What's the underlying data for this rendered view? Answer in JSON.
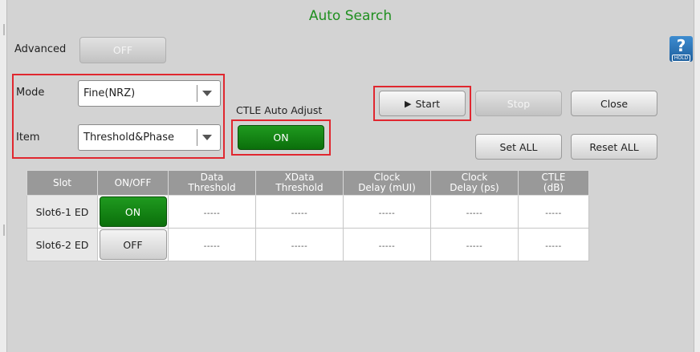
{
  "window": {
    "title": "Auto Search"
  },
  "advanced": {
    "label": "Advanced",
    "toggle": "OFF"
  },
  "mode": {
    "label": "Mode",
    "value": "Fine(NRZ)"
  },
  "item": {
    "label": "Item",
    "value": "Threshold&Phase"
  },
  "ctle": {
    "label": "CTLE Auto Adjust",
    "toggle": "ON"
  },
  "buttons": {
    "start": "Start",
    "start_glyph": "▶",
    "stop": "Stop",
    "close": "Close",
    "set_all": "Set ALL",
    "reset_all": "Reset ALL"
  },
  "help": {
    "glyph": "?",
    "caption": "HOLD"
  },
  "table": {
    "headers": [
      [
        "Slot"
      ],
      [
        "ON/OFF"
      ],
      [
        "Data",
        "Threshold"
      ],
      [
        "XData",
        "Threshold"
      ],
      [
        "Clock",
        "Delay (mUI)"
      ],
      [
        "Clock",
        "Delay (ps)"
      ],
      [
        "CTLE",
        "(dB)"
      ]
    ],
    "rows": [
      {
        "slot": "Slot6-1 ED",
        "state": "ON",
        "cells": [
          "-----",
          "-----",
          "-----",
          "-----",
          "-----"
        ]
      },
      {
        "slot": "Slot6-2 ED",
        "state": "OFF",
        "cells": [
          "-----",
          "-----",
          "-----",
          "-----",
          "-----"
        ]
      }
    ]
  },
  "colors": {
    "title": "#1f8f1f",
    "on_green": "#0b6f0b",
    "highlight_red": "#e0272f",
    "header_gray": "#999999",
    "help_blue": "#1e5f9d"
  }
}
